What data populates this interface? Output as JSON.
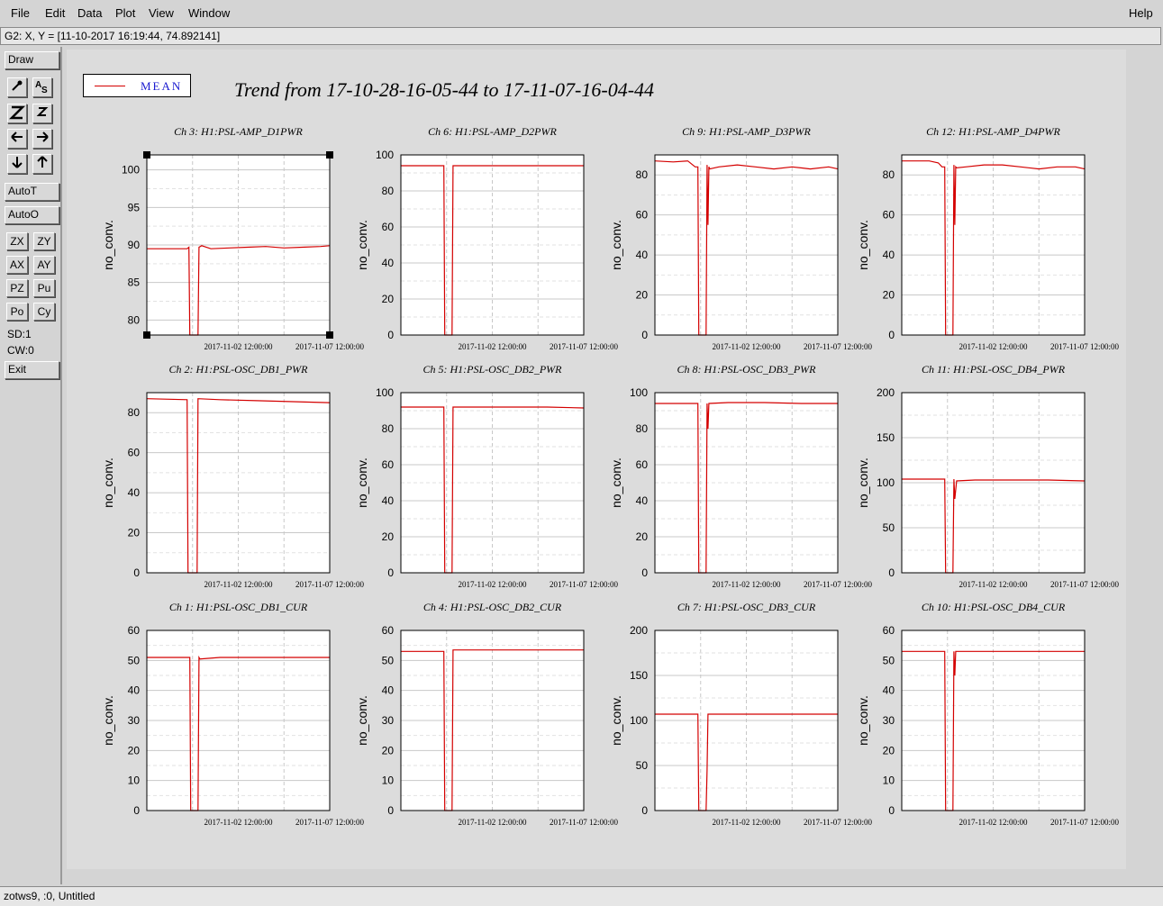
{
  "menus": {
    "file": "File",
    "edit": "Edit",
    "data": "Data",
    "plot": "Plot",
    "view": "View",
    "window": "Window",
    "help": "Help"
  },
  "coord_readout": "G2: X, Y = [11-10-2017 16:19:44, 74.892141]",
  "toolbox": {
    "draw": "Draw",
    "auto_t": "AutoT",
    "auto_o": "AutoO",
    "zx": "ZX",
    "zy": "ZY",
    "ax": "AX",
    "ay": "AY",
    "pz": "PZ",
    "pu": "Pu",
    "po": "Po",
    "cy": "Cy",
    "sd": "SD:1",
    "cw": "CW:0",
    "exit": "Exit"
  },
  "legend": {
    "label": "MEAN",
    "color": "#d40000"
  },
  "trend_title": "Trend from 17-10-28-16-05-44 to 17-11-07-16-04-44",
  "status": "zotws9, :0, Untitled",
  "chart_data": [
    {
      "type": "line",
      "title": "Ch 3: H1:PSL-AMP_D1PWR",
      "ylabel": "no_conv.",
      "xticks": [
        "2017-11-02 12:00:00",
        "2017-11-07 12:00:00"
      ],
      "ylim": [
        78,
        102
      ],
      "yticks": [
        80,
        85,
        90,
        95,
        100
      ],
      "series": [
        {
          "name": "MEAN",
          "color": "#d40000",
          "x": [
            0,
            0.22,
            0.23,
            0.235,
            0.28,
            0.285,
            0.3,
            0.35,
            0.45,
            0.55,
            0.65,
            0.75,
            0.85,
            0.95,
            1
          ],
          "y": [
            89.5,
            89.5,
            89.7,
            78,
            78,
            89.7,
            89.9,
            89.5,
            89.6,
            89.7,
            89.8,
            89.6,
            89.7,
            89.8,
            89.9
          ]
        }
      ]
    },
    {
      "type": "line",
      "title": "Ch 6: H1:PSL-AMP_D2PWR",
      "ylabel": "no_conv.",
      "xticks": [
        "2017-11-02 12:00:00",
        "2017-11-07 12:00:00"
      ],
      "ylim": [
        0,
        100
      ],
      "yticks": [
        0,
        20,
        40,
        60,
        80,
        100
      ],
      "series": [
        {
          "name": "MEAN",
          "color": "#d40000",
          "x": [
            0,
            0.235,
            0.24,
            0.28,
            0.285,
            1
          ],
          "y": [
            94,
            94,
            0,
            0,
            94,
            94
          ]
        }
      ]
    },
    {
      "type": "line",
      "title": "Ch 9: H1:PSL-AMP_D3PWR",
      "ylabel": "no_conv.",
      "xticks": [
        "2017-11-02 12:00:00",
        "2017-11-07 12:00:00"
      ],
      "ylim": [
        0,
        90
      ],
      "yticks": [
        0,
        20,
        40,
        60,
        80
      ],
      "series": [
        {
          "name": "MEAN",
          "color": "#d40000",
          "x": [
            0,
            0.1,
            0.18,
            0.22,
            0.235,
            0.24,
            0.28,
            0.285,
            0.29,
            0.295,
            0.3,
            0.35,
            0.45,
            0.55,
            0.65,
            0.75,
            0.85,
            0.95,
            1
          ],
          "y": [
            87,
            86.5,
            87,
            84,
            84,
            0,
            0,
            85,
            55,
            84,
            83,
            84,
            85,
            84,
            83,
            84,
            83,
            84,
            83
          ]
        }
      ]
    },
    {
      "type": "line",
      "title": "Ch 12: H1:PSL-AMP_D4PWR",
      "ylabel": "no_conv.",
      "xticks": [
        "2017-11-02 12:00:00",
        "2017-11-07 12:00:00"
      ],
      "ylim": [
        0,
        90
      ],
      "yticks": [
        0,
        20,
        40,
        60,
        80
      ],
      "series": [
        {
          "name": "MEAN",
          "color": "#d40000",
          "x": [
            0,
            0.15,
            0.2,
            0.22,
            0.235,
            0.24,
            0.28,
            0.285,
            0.29,
            0.295,
            0.3,
            0.35,
            0.45,
            0.55,
            0.65,
            0.75,
            0.85,
            0.95,
            1
          ],
          "y": [
            87,
            87,
            86,
            84,
            84,
            0,
            0,
            85,
            55,
            84,
            83.5,
            84,
            85,
            85,
            84,
            83,
            84,
            84,
            83
          ]
        }
      ]
    },
    {
      "type": "line",
      "title": "Ch 2: H1:PSL-OSC_DB1_PWR",
      "ylabel": "no_conv.",
      "xticks": [
        "2017-11-02 12:00:00",
        "2017-11-07 12:00:00"
      ],
      "ylim": [
        0,
        90
      ],
      "yticks": [
        0,
        20,
        40,
        60,
        80
      ],
      "series": [
        {
          "name": "MEAN",
          "color": "#d40000",
          "x": [
            0,
            0.22,
            0.225,
            0.275,
            0.28,
            0.4,
            0.6,
            0.8,
            1
          ],
          "y": [
            87,
            86.5,
            0,
            0,
            87,
            86.5,
            86,
            85.5,
            85
          ]
        }
      ]
    },
    {
      "type": "line",
      "title": "Ch 5: H1:PSL-OSC_DB2_PWR",
      "ylabel": "no_conv.",
      "xticks": [
        "2017-11-02 12:00:00",
        "2017-11-07 12:00:00"
      ],
      "ylim": [
        0,
        100
      ],
      "yticks": [
        0,
        20,
        40,
        60,
        80,
        100
      ],
      "series": [
        {
          "name": "MEAN",
          "color": "#d40000",
          "x": [
            0,
            0.235,
            0.24,
            0.28,
            0.285,
            0.4,
            0.6,
            0.8,
            1
          ],
          "y": [
            92,
            92,
            0,
            0,
            92,
            92,
            92,
            92,
            91.5
          ]
        }
      ]
    },
    {
      "type": "line",
      "title": "Ch 8: H1:PSL-OSC_DB3_PWR",
      "ylabel": "no_conv.",
      "xticks": [
        "2017-11-02 12:00:00",
        "2017-11-07 12:00:00"
      ],
      "ylim": [
        0,
        100
      ],
      "yticks": [
        0,
        20,
        40,
        60,
        80,
        100
      ],
      "series": [
        {
          "name": "MEAN",
          "color": "#d40000",
          "x": [
            0,
            0.235,
            0.24,
            0.28,
            0.285,
            0.29,
            0.295,
            0.4,
            0.6,
            0.8,
            1
          ],
          "y": [
            94,
            94,
            0,
            0,
            94,
            80,
            94,
            94.5,
            94.5,
            94,
            94
          ]
        }
      ]
    },
    {
      "type": "line",
      "title": "Ch 11: H1:PSL-OSC_DB4_PWR",
      "ylabel": "no_conv.",
      "xticks": [
        "2017-11-02 12:00:00",
        "2017-11-07 12:00:00"
      ],
      "ylim": [
        0,
        200
      ],
      "yticks": [
        0,
        50,
        100,
        150,
        200
      ],
      "series": [
        {
          "name": "MEAN",
          "color": "#d40000",
          "x": [
            0,
            0.235,
            0.24,
            0.28,
            0.285,
            0.29,
            0.3,
            0.4,
            0.6,
            0.8,
            1
          ],
          "y": [
            104,
            104,
            0,
            0,
            104,
            82,
            102,
            103,
            103,
            103,
            102
          ]
        }
      ]
    },
    {
      "type": "line",
      "title": "Ch 1: H1:PSL-OSC_DB1_CUR",
      "ylabel": "no_conv.",
      "xticks": [
        "2017-11-02 12:00:00",
        "2017-11-07 12:00:00"
      ],
      "ylim": [
        0,
        60
      ],
      "yticks": [
        0,
        10,
        20,
        30,
        40,
        50,
        60
      ],
      "series": [
        {
          "name": "MEAN",
          "color": "#d40000",
          "x": [
            0,
            0.235,
            0.24,
            0.28,
            0.285,
            0.29,
            0.4,
            0.6,
            0.8,
            1
          ],
          "y": [
            51,
            51,
            0,
            0,
            51,
            50.5,
            51,
            51,
            51,
            51
          ]
        }
      ]
    },
    {
      "type": "line",
      "title": "Ch 4: H1:PSL-OSC_DB2_CUR",
      "ylabel": "no_conv.",
      "xticks": [
        "2017-11-02 12:00:00",
        "2017-11-07 12:00:00"
      ],
      "ylim": [
        0,
        60
      ],
      "yticks": [
        0,
        10,
        20,
        30,
        40,
        50,
        60
      ],
      "series": [
        {
          "name": "MEAN",
          "color": "#d40000",
          "x": [
            0,
            0.235,
            0.24,
            0.28,
            0.285,
            0.4,
            0.6,
            0.8,
            1
          ],
          "y": [
            53,
            53,
            0,
            0,
            53.5,
            53.5,
            53.5,
            53.5,
            53.5
          ]
        }
      ]
    },
    {
      "type": "line",
      "title": "Ch 7: H1:PSL-OSC_DB3_CUR",
      "ylabel": "no_conv.",
      "xticks": [
        "2017-11-02 12:00:00",
        "2017-11-07 12:00:00"
      ],
      "ylim": [
        0,
        200
      ],
      "yticks": [
        0,
        50,
        100,
        150,
        200
      ],
      "series": [
        {
          "name": "MEAN",
          "color": "#d40000",
          "x": [
            0,
            0.235,
            0.24,
            0.28,
            0.285,
            0.29,
            0.295,
            0.4,
            0.6,
            0.8,
            1
          ],
          "y": [
            107,
            107,
            0,
            0,
            45,
            107,
            107,
            107,
            107,
            107,
            107
          ]
        }
      ]
    },
    {
      "type": "line",
      "title": "Ch 10: H1:PSL-OSC_DB4_CUR",
      "ylabel": "no_conv.",
      "xticks": [
        "2017-11-02 12:00:00",
        "2017-11-07 12:00:00"
      ],
      "ylim": [
        0,
        60
      ],
      "yticks": [
        0,
        10,
        20,
        30,
        40,
        50,
        60
      ],
      "series": [
        {
          "name": "MEAN",
          "color": "#d40000",
          "x": [
            0,
            0.235,
            0.24,
            0.28,
            0.285,
            0.29,
            0.295,
            0.4,
            0.6,
            0.8,
            1
          ],
          "y": [
            53,
            53,
            0,
            0,
            53,
            45,
            53,
            53,
            53,
            53,
            53
          ]
        }
      ]
    }
  ]
}
